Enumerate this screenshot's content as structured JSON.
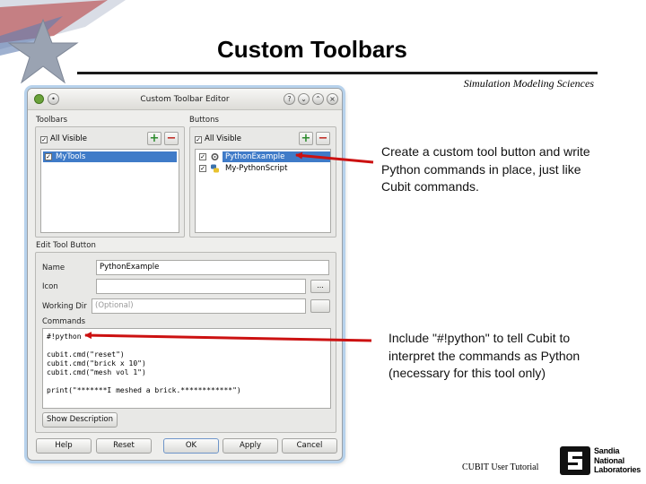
{
  "slide": {
    "title": "Custom Toolbars",
    "subtitle": "Simulation Modeling Sciences",
    "footer": "CUBIT User Tutorial",
    "logo_lines": [
      "Sandia",
      "National",
      "Laboratories"
    ]
  },
  "dialog": {
    "title": "Custom Toolbar Editor",
    "toolbars": {
      "label": "Toolbars",
      "all_visible": "All Visible",
      "items": [
        {
          "label": "MyTools",
          "checked": true,
          "selected": true
        }
      ]
    },
    "buttons": {
      "label": "Buttons",
      "all_visible": "All Visible",
      "items": [
        {
          "label": "PythonExample",
          "checked": true,
          "selected": true
        },
        {
          "label": "My-PythonScript",
          "checked": true,
          "selected": false
        }
      ]
    },
    "plus_symbol": "+",
    "minus_symbol": "−",
    "edit": {
      "label": "Edit Tool Button",
      "name_label": "Name",
      "name_value": "PythonExample",
      "icon_label": "Icon",
      "icon_value": "",
      "browse_label": "...",
      "workdir_label": "Working Dir",
      "workdir_placeholder": "(Optional)",
      "commands_label": "Commands",
      "commands_text": "#!python\n\ncubit.cmd(\"reset\")\ncubit.cmd(\"brick x 10\")\ncubit.cmd(\"mesh vol 1\")\n\nprint(\"*******I meshed a brick.************\")",
      "show_description": "Show Description"
    },
    "footer_buttons": [
      "Help",
      "Reset",
      "OK",
      "Apply",
      "Cancel"
    ]
  },
  "callouts": {
    "top": "Create a custom tool button and write Python commands in place, just like Cubit commands.",
    "bottom": "Include \"#!python\" to tell Cubit to interpret the commands as Python (necessary for this tool only)"
  },
  "colors": {
    "arrow": "#cc1111",
    "selection": "#3f7bc8",
    "title_rule": "#1a1a1a"
  }
}
